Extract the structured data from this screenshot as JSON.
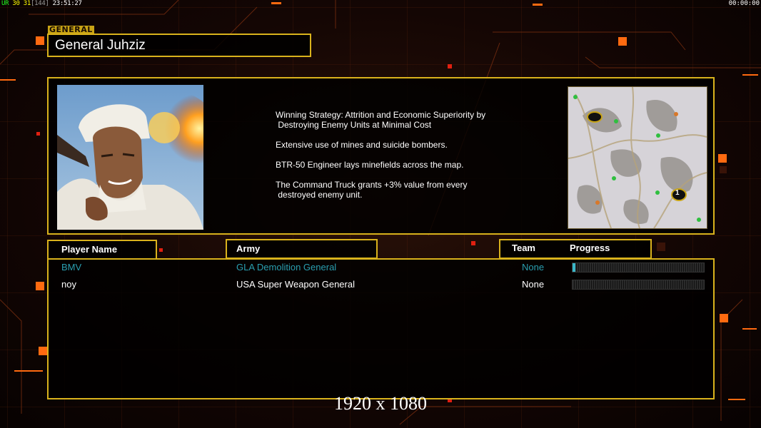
{
  "hud": {
    "left_parts": [
      {
        "text": "UR",
        "color": "g"
      },
      {
        "text": " 30",
        "color": "y"
      },
      {
        "text": " 31",
        "color": "y"
      },
      {
        "text": "[144]",
        "color": "gray"
      },
      {
        "text": " 23:51:27",
        "color": "w"
      }
    ],
    "right_time": "00:00:00"
  },
  "general": {
    "section_label": "GENERAL",
    "name": "General Juhziz"
  },
  "strategy": {
    "paragraphs": [
      "Winning Strategy: Attrition and Economic Superiority by\n Destroying Enemy Units at Minimal Cost",
      "Extensive use of mines and suicide bombers.",
      "BTR-50 Engineer lays minefields across the map.",
      "The Command Truck grants +3% value from every\n destroyed enemy unit."
    ]
  },
  "minimap": {
    "start_marker": "1"
  },
  "table": {
    "headers": {
      "player_name": "Player Name",
      "army": "Army",
      "team": "Team",
      "progress": "Progress"
    },
    "rows": [
      {
        "player": "BMV",
        "army": "GLA Demolition General",
        "team": "None",
        "progress": 0.02,
        "color": "#2a9fb0"
      },
      {
        "player": "noy",
        "army": "USA Super Weapon General",
        "team": "None",
        "progress": 0.0,
        "color": "#ffffff"
      }
    ]
  },
  "resolution_label": "1920 x 1080",
  "colors": {
    "gold_border": "#d9b21c",
    "accent_orange": "#ff6a10",
    "team_cyan": "#2a9fb0"
  }
}
